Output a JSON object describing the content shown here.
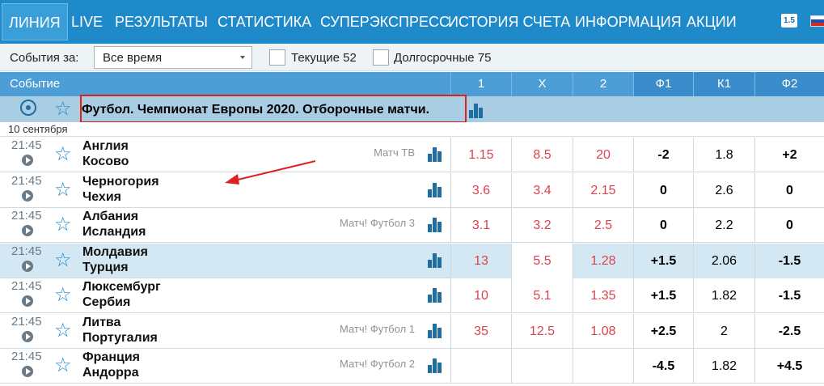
{
  "nav": {
    "items": [
      "ЛИНИЯ",
      "LIVE",
      "РЕЗУЛЬТАТЫ",
      "СТАТИСТИКА",
      "СУПЕРЭКСПРЕСС",
      "ИСТОРИЯ СЧЕТА",
      "ИНФОРМАЦИЯ",
      "АКЦИИ"
    ],
    "badge": "1.5"
  },
  "filter": {
    "label": "События за:",
    "select_value": "Все время",
    "current_label": "Текущие 52",
    "longterm_label": "Долгосрочные 75"
  },
  "table": {
    "headers": [
      "Событие",
      "1",
      "X",
      "2",
      "Ф1",
      "К1",
      "Ф2"
    ],
    "championship": "Футбол. Чемпионат Европы 2020. Отборочные матчи.",
    "date": "10 сентября",
    "rows": [
      {
        "time": "21:45",
        "home": "Англия",
        "away": "Косово",
        "tv": "Матч ТВ",
        "o1": "1.15",
        "ox": "8.5",
        "o2": "20",
        "f1": "-2",
        "k1": "1.8",
        "f2": "+2"
      },
      {
        "time": "21:45",
        "home": "Черногория",
        "away": "Чехия",
        "tv": "",
        "o1": "3.6",
        "ox": "3.4",
        "o2": "2.15",
        "f1": "0",
        "k1": "2.6",
        "f2": "0"
      },
      {
        "time": "21:45",
        "home": "Албания",
        "away": "Исландия",
        "tv": "Матч! Футбол 3",
        "o1": "3.1",
        "ox": "3.2",
        "o2": "2.5",
        "f1": "0",
        "k1": "2.2",
        "f2": "0"
      },
      {
        "time": "21:45",
        "home": "Молдавия",
        "away": "Турция",
        "tv": "",
        "o1": "13",
        "ox": "5.5",
        "o2": "1.28",
        "f1": "+1.5",
        "k1": "2.06",
        "f2": "-1.5"
      },
      {
        "time": "21:45",
        "home": "Люксембург",
        "away": "Сербия",
        "tv": "",
        "o1": "10",
        "ox": "5.1",
        "o2": "1.35",
        "f1": "+1.5",
        "k1": "1.82",
        "f2": "-1.5"
      },
      {
        "time": "21:45",
        "home": "Литва",
        "away": "Португалия",
        "tv": "Матч! Футбол 1",
        "o1": "35",
        "ox": "12.5",
        "o2": "1.08",
        "f1": "+2.5",
        "k1": "2",
        "f2": "-2.5"
      },
      {
        "time": "21:45",
        "home": "Франция",
        "away": "Андорра",
        "tv": "Матч! Футбол 2",
        "o1": "",
        "ox": "",
        "o2": "",
        "f1": "-4.5",
        "k1": "1.82",
        "f2": "+4.5"
      }
    ]
  },
  "icons": {
    "ball": "soccer-ball-icon",
    "star": "star-icon",
    "play": "play-icon",
    "stats": "bar-chart-icon"
  },
  "colors": {
    "nav_bg": "#1f8ac9",
    "header_bg": "#4d9ed6",
    "champ_bg": "#a9cde3",
    "odd_text": "#d9434e",
    "highlight_box": "#e02020"
  }
}
